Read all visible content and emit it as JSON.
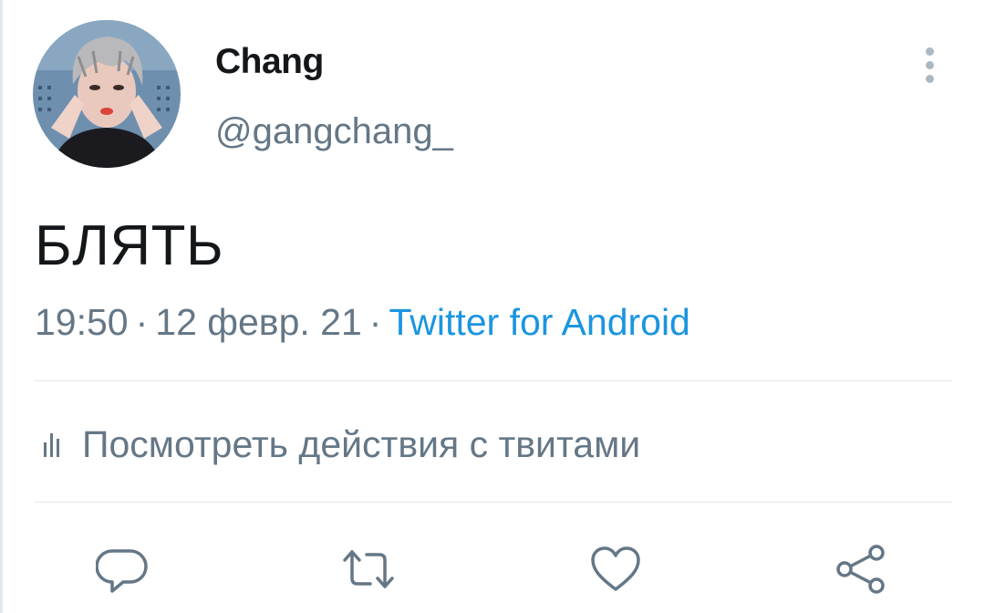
{
  "tweet": {
    "author": {
      "display_name": "Chang",
      "username": "@gangchang_"
    },
    "text": "БЛЯТЬ",
    "time": "19:50",
    "date": "12 февр. 21",
    "separator": "·",
    "source": "Twitter for Android"
  },
  "activity": {
    "label": "Посмотреть действия с твитами",
    "icon": "bar-chart-icon"
  },
  "actions": {
    "reply_icon": "comment-icon",
    "retweet_icon": "retweet-icon",
    "like_icon": "heart-icon",
    "share_icon": "share-icon"
  },
  "colors": {
    "text": "#14171a",
    "secondary": "#657786",
    "link": "#1b95e0",
    "divider": "#e1e8ed",
    "icon": "#657786"
  }
}
